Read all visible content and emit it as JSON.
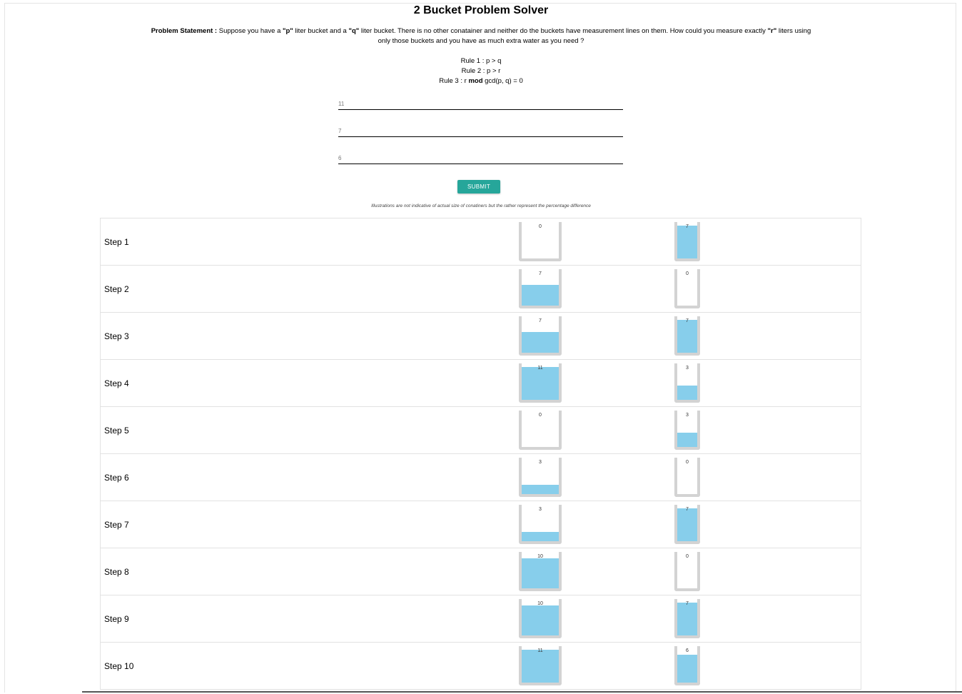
{
  "title": "2 Bucket Problem Solver",
  "problem": {
    "label": "Problem Statement :",
    "text_1": " Suppose you have a ",
    "p": "\"p\"",
    "text_2": " liter bucket and a ",
    "q": "\"q\"",
    "text_3": " liter bucket. There is no other conatainer and neither do the buckets have measurement lines on them. How could you measure exactly ",
    "r": "\"r\"",
    "text_4": " liters using only those buckets and you have as much extra water as you need ?"
  },
  "rules": {
    "rule1": "Rule 1 : p > q",
    "rule2": "Rule 2 : p > r",
    "rule3_prefix": "Rule 3 : r ",
    "rule3_mod": "mod",
    "rule3_suffix": " gcd(p, q) = 0"
  },
  "inputs": {
    "p_value": "11",
    "q_value": "7",
    "r_value": "6"
  },
  "submit_label": "SUBMIT",
  "note": "Illustrations are not indicative of actual size of conatiners but the rather represent the percentage difference",
  "capacities": {
    "p": 11,
    "q": 7
  },
  "colors": {
    "water": "#87ceeb",
    "accent": "#26a69a",
    "bucket_wall": "#d3d3d3"
  },
  "steps": [
    {
      "label": "Step 1",
      "a": 0,
      "b": 7
    },
    {
      "label": "Step 2",
      "a": 7,
      "b": 0
    },
    {
      "label": "Step 3",
      "a": 7,
      "b": 7
    },
    {
      "label": "Step 4",
      "a": 11,
      "b": 3
    },
    {
      "label": "Step 5",
      "a": 0,
      "b": 3
    },
    {
      "label": "Step 6",
      "a": 3,
      "b": 0
    },
    {
      "label": "Step 7",
      "a": 3,
      "b": 7
    },
    {
      "label": "Step 8",
      "a": 10,
      "b": 0
    },
    {
      "label": "Step 9",
      "a": 10,
      "b": 7
    },
    {
      "label": "Step 10",
      "a": 11,
      "b": 6
    }
  ]
}
